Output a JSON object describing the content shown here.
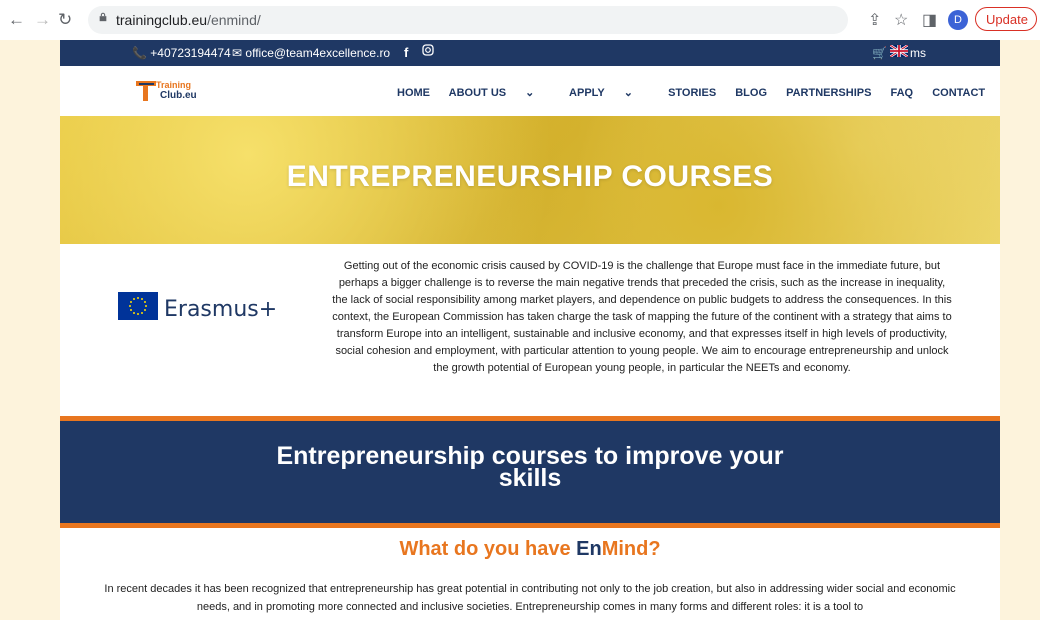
{
  "browser": {
    "url_domain": "trainingclub.eu",
    "url_path": "/enmind/",
    "avatar_letter": "D",
    "update_label": "Update"
  },
  "topbar": {
    "phone": "+40723194474",
    "email": "office@team4excellence.ro",
    "facebook": "f",
    "cart_suffix": "ms"
  },
  "logo": {
    "line1": "Training",
    "line2": "Club.eu"
  },
  "nav": {
    "home": "HOME",
    "about": "ABOUT US",
    "apply": "APPLY",
    "stories": "STORIES",
    "blog": "BLOG",
    "partnerships": "PARTNERSHIPS",
    "faq": "FAQ",
    "contact": "CONTACT"
  },
  "hero": {
    "title": "ENTREPRENEURSHIP COURSES"
  },
  "erasmus": {
    "label": "Erasmus+"
  },
  "intro": {
    "text": "Getting out of the economic crisis caused by COVID-19 is the challenge that Europe must face in the immediate future, but perhaps a bigger challenge is to reverse the main negative trends that preceded the crisis, such as the increase in inequality, the lack of social responsibility among market players, and dependence on public budgets to address the consequences. In this context, the European Commission has taken charge the task of mapping the future of the continent with a strategy that aims to transform Europe into an intelligent, sustainable and inclusive economy, and that expresses itself in high levels of productivity, social cohesion and employment, with particular attention to young people. We aim to encourage entrepreneurship and unlock the growth potential of European young people, in particular the NEETs and economy."
  },
  "band": {
    "line1": "Entrepreneurship courses to improve your",
    "line2": "skills"
  },
  "enmind": {
    "prefix": "What do you have ",
    "highlight": "En",
    "suffix": "Mind?"
  },
  "bottom": {
    "text": "In recent decades it has been recognized that entrepreneurship has great potential in contributing not only to the job creation, but also in addressing wider social and economic needs, and in promoting more connected and inclusive societies. Entrepreneurship comes in many forms and different roles: it is a tool to"
  },
  "colors": {
    "navy": "#1f3864",
    "orange": "#e8761f"
  }
}
